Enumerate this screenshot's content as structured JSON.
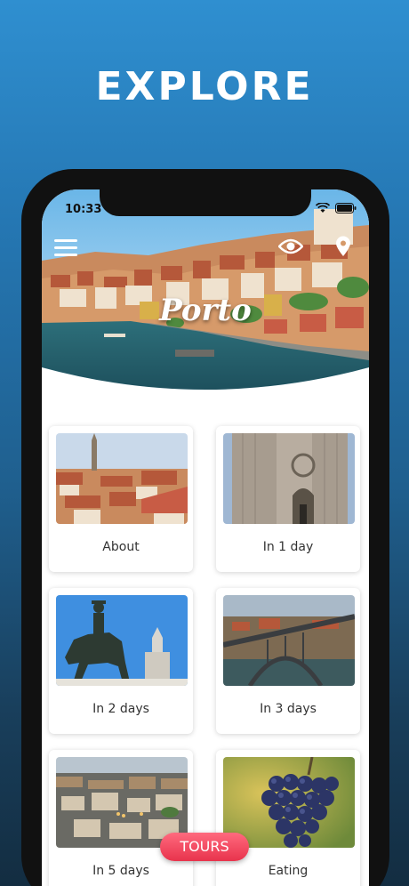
{
  "promo": {
    "title": "EXPLORE"
  },
  "status_bar": {
    "time": "10:33"
  },
  "hero": {
    "city_name": "Porto"
  },
  "cards": [
    {
      "label": "About",
      "image": "porto-rooftops-clerigos"
    },
    {
      "label": "In 1 day",
      "image": "porto-cathedral"
    },
    {
      "label": "In 2 days",
      "image": "equestrian-statue"
    },
    {
      "label": "In 3 days",
      "image": "dom-luis-bridge"
    },
    {
      "label": "In 5 days",
      "image": "city-panorama"
    },
    {
      "label": "Eating",
      "image": "grapes"
    }
  ],
  "tours_button": {
    "label": "TOURS"
  },
  "icons": {
    "menu": "menu-icon",
    "eye": "eye-icon",
    "map": "map-pin-icon",
    "wifi": "wifi-icon",
    "battery": "battery-icon"
  },
  "colors": {
    "accent": "#e8334c",
    "background_top": "#2f8fd0",
    "background_bottom": "#132d41"
  }
}
